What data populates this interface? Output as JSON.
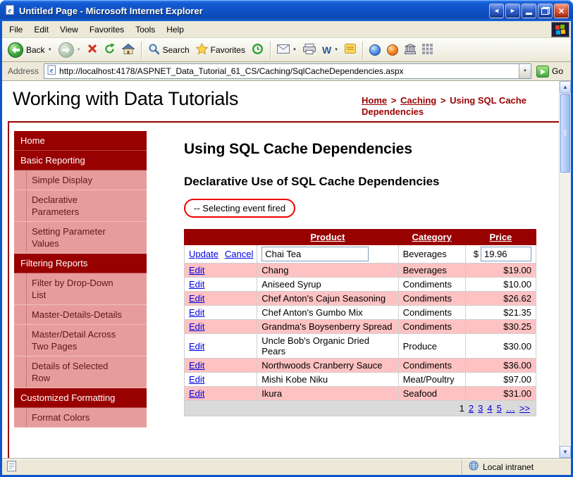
{
  "window": {
    "title": "Untitled Page - Microsoft Internet Explorer",
    "menu": [
      "File",
      "Edit",
      "View",
      "Favorites",
      "Tools",
      "Help"
    ],
    "toolbar": {
      "back_label": "Back",
      "search_label": "Search",
      "favorites_label": "Favorites",
      "word_logo": "W"
    },
    "address": {
      "label": "Address",
      "value": "http://localhost:4178/ASPNET_Data_Tutorial_61_CS/Caching/SqlCacheDependencies.aspx",
      "go_label": "Go"
    },
    "status": {
      "zone_label": "Local intranet"
    },
    "icons": {
      "dropdown": "▼",
      "arrow_left": "◄",
      "arrow_right": "►",
      "close": "×",
      "scroll_up": "▲",
      "scroll_down": "▼"
    }
  },
  "page": {
    "site_title": "Working with Data Tutorials",
    "breadcrumb": {
      "home": "Home",
      "sep": ">",
      "section": "Caching",
      "current": "Using SQL Cache Dependencies"
    },
    "sidebar": [
      {
        "label": "Home",
        "type": "section"
      },
      {
        "label": "Basic Reporting",
        "type": "section"
      },
      {
        "label": "Simple Display",
        "type": "item"
      },
      {
        "label": "Declarative Parameters",
        "type": "item"
      },
      {
        "label": "Setting Parameter Values",
        "type": "item"
      },
      {
        "label": "Filtering Reports",
        "type": "section"
      },
      {
        "label": "Filter by Drop-Down List",
        "type": "item"
      },
      {
        "label": "Master-Details-Details",
        "type": "item"
      },
      {
        "label": "Master/Detail Across Two Pages",
        "type": "item"
      },
      {
        "label": "Details of Selected Row",
        "type": "item"
      },
      {
        "label": "Customized Formatting",
        "type": "section"
      },
      {
        "label": "Format Colors",
        "type": "item"
      }
    ],
    "main": {
      "heading": "Using SQL Cache Dependencies",
      "subheading": "Declarative Use of SQL Cache Dependencies",
      "annotation": "-- Selecting event fired"
    },
    "grid": {
      "headers": {
        "product": "Product",
        "category": "Category",
        "price": "Price"
      },
      "edit_row": {
        "update": "Update",
        "cancel": "Cancel",
        "product": "Chai Tea",
        "category": "Beverages",
        "currency": "$",
        "price": "19.96"
      },
      "rows": [
        {
          "action": "Edit",
          "product": "Chang",
          "category": "Beverages",
          "price": "$19.00"
        },
        {
          "action": "Edit",
          "product": "Aniseed Syrup",
          "category": "Condiments",
          "price": "$10.00"
        },
        {
          "action": "Edit",
          "product": "Chef Anton's Cajun Seasoning",
          "category": "Condiments",
          "price": "$26.62"
        },
        {
          "action": "Edit",
          "product": "Chef Anton's Gumbo Mix",
          "category": "Condiments",
          "price": "$21.35"
        },
        {
          "action": "Edit",
          "product": "Grandma's Boysenberry Spread",
          "category": "Condiments",
          "price": "$30.25"
        },
        {
          "action": "Edit",
          "product": "Uncle Bob's Organic Dried Pears",
          "category": "Produce",
          "price": "$30.00"
        },
        {
          "action": "Edit",
          "product": "Northwoods Cranberry Sauce",
          "category": "Condiments",
          "price": "$36.00"
        },
        {
          "action": "Edit",
          "product": "Mishi Kobe Niku",
          "category": "Meat/Poultry",
          "price": "$97.00"
        },
        {
          "action": "Edit",
          "product": "Ikura",
          "category": "Seafood",
          "price": "$31.00"
        }
      ],
      "pager": {
        "current": "1",
        "p2": "2",
        "p3": "3",
        "p4": "4",
        "p5": "5",
        "more": "…",
        "next": ">>"
      }
    }
  },
  "colors": {
    "maroon": "#990000",
    "sidebar_pink": "#e79c9c",
    "row_pink": "#ffc2c2",
    "link_blue": "#0000e0",
    "annotation_red": "#ee0000",
    "pager_gray": "#dadada",
    "titlebar_blue": "#0f51c4"
  }
}
